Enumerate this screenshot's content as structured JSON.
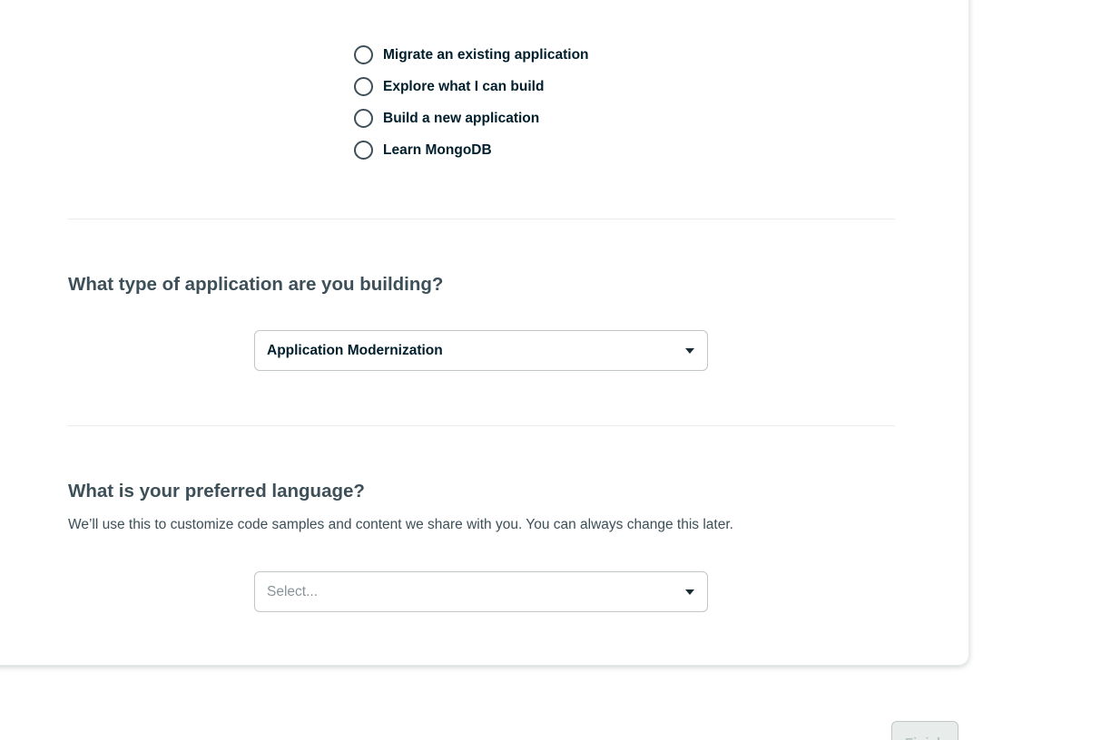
{
  "goal_options": [
    {
      "label": "Migrate an existing application"
    },
    {
      "label": "Explore what I can build"
    },
    {
      "label": "Build a new application"
    },
    {
      "label": "Learn MongoDB"
    }
  ],
  "app_type": {
    "question": "What type of application are you building?",
    "selected_value": "Application Modernization"
  },
  "language": {
    "question": "What is your preferred language?",
    "description": "We’ll use this to customize code samples and content we share with you. You can always change this later.",
    "placeholder": "Select..."
  },
  "footer": {
    "finish_label": "Finish"
  },
  "icons": {
    "radio": "radio-unchecked-icon",
    "caret": "caret-down-icon"
  },
  "colors": {
    "text_primary": "#001e2b",
    "text_secondary": "#3d4f58",
    "border": "#c1c7c6",
    "divider": "#e8edeb",
    "placeholder": "#889397",
    "button_disabled_bg": "#e8edeb"
  }
}
